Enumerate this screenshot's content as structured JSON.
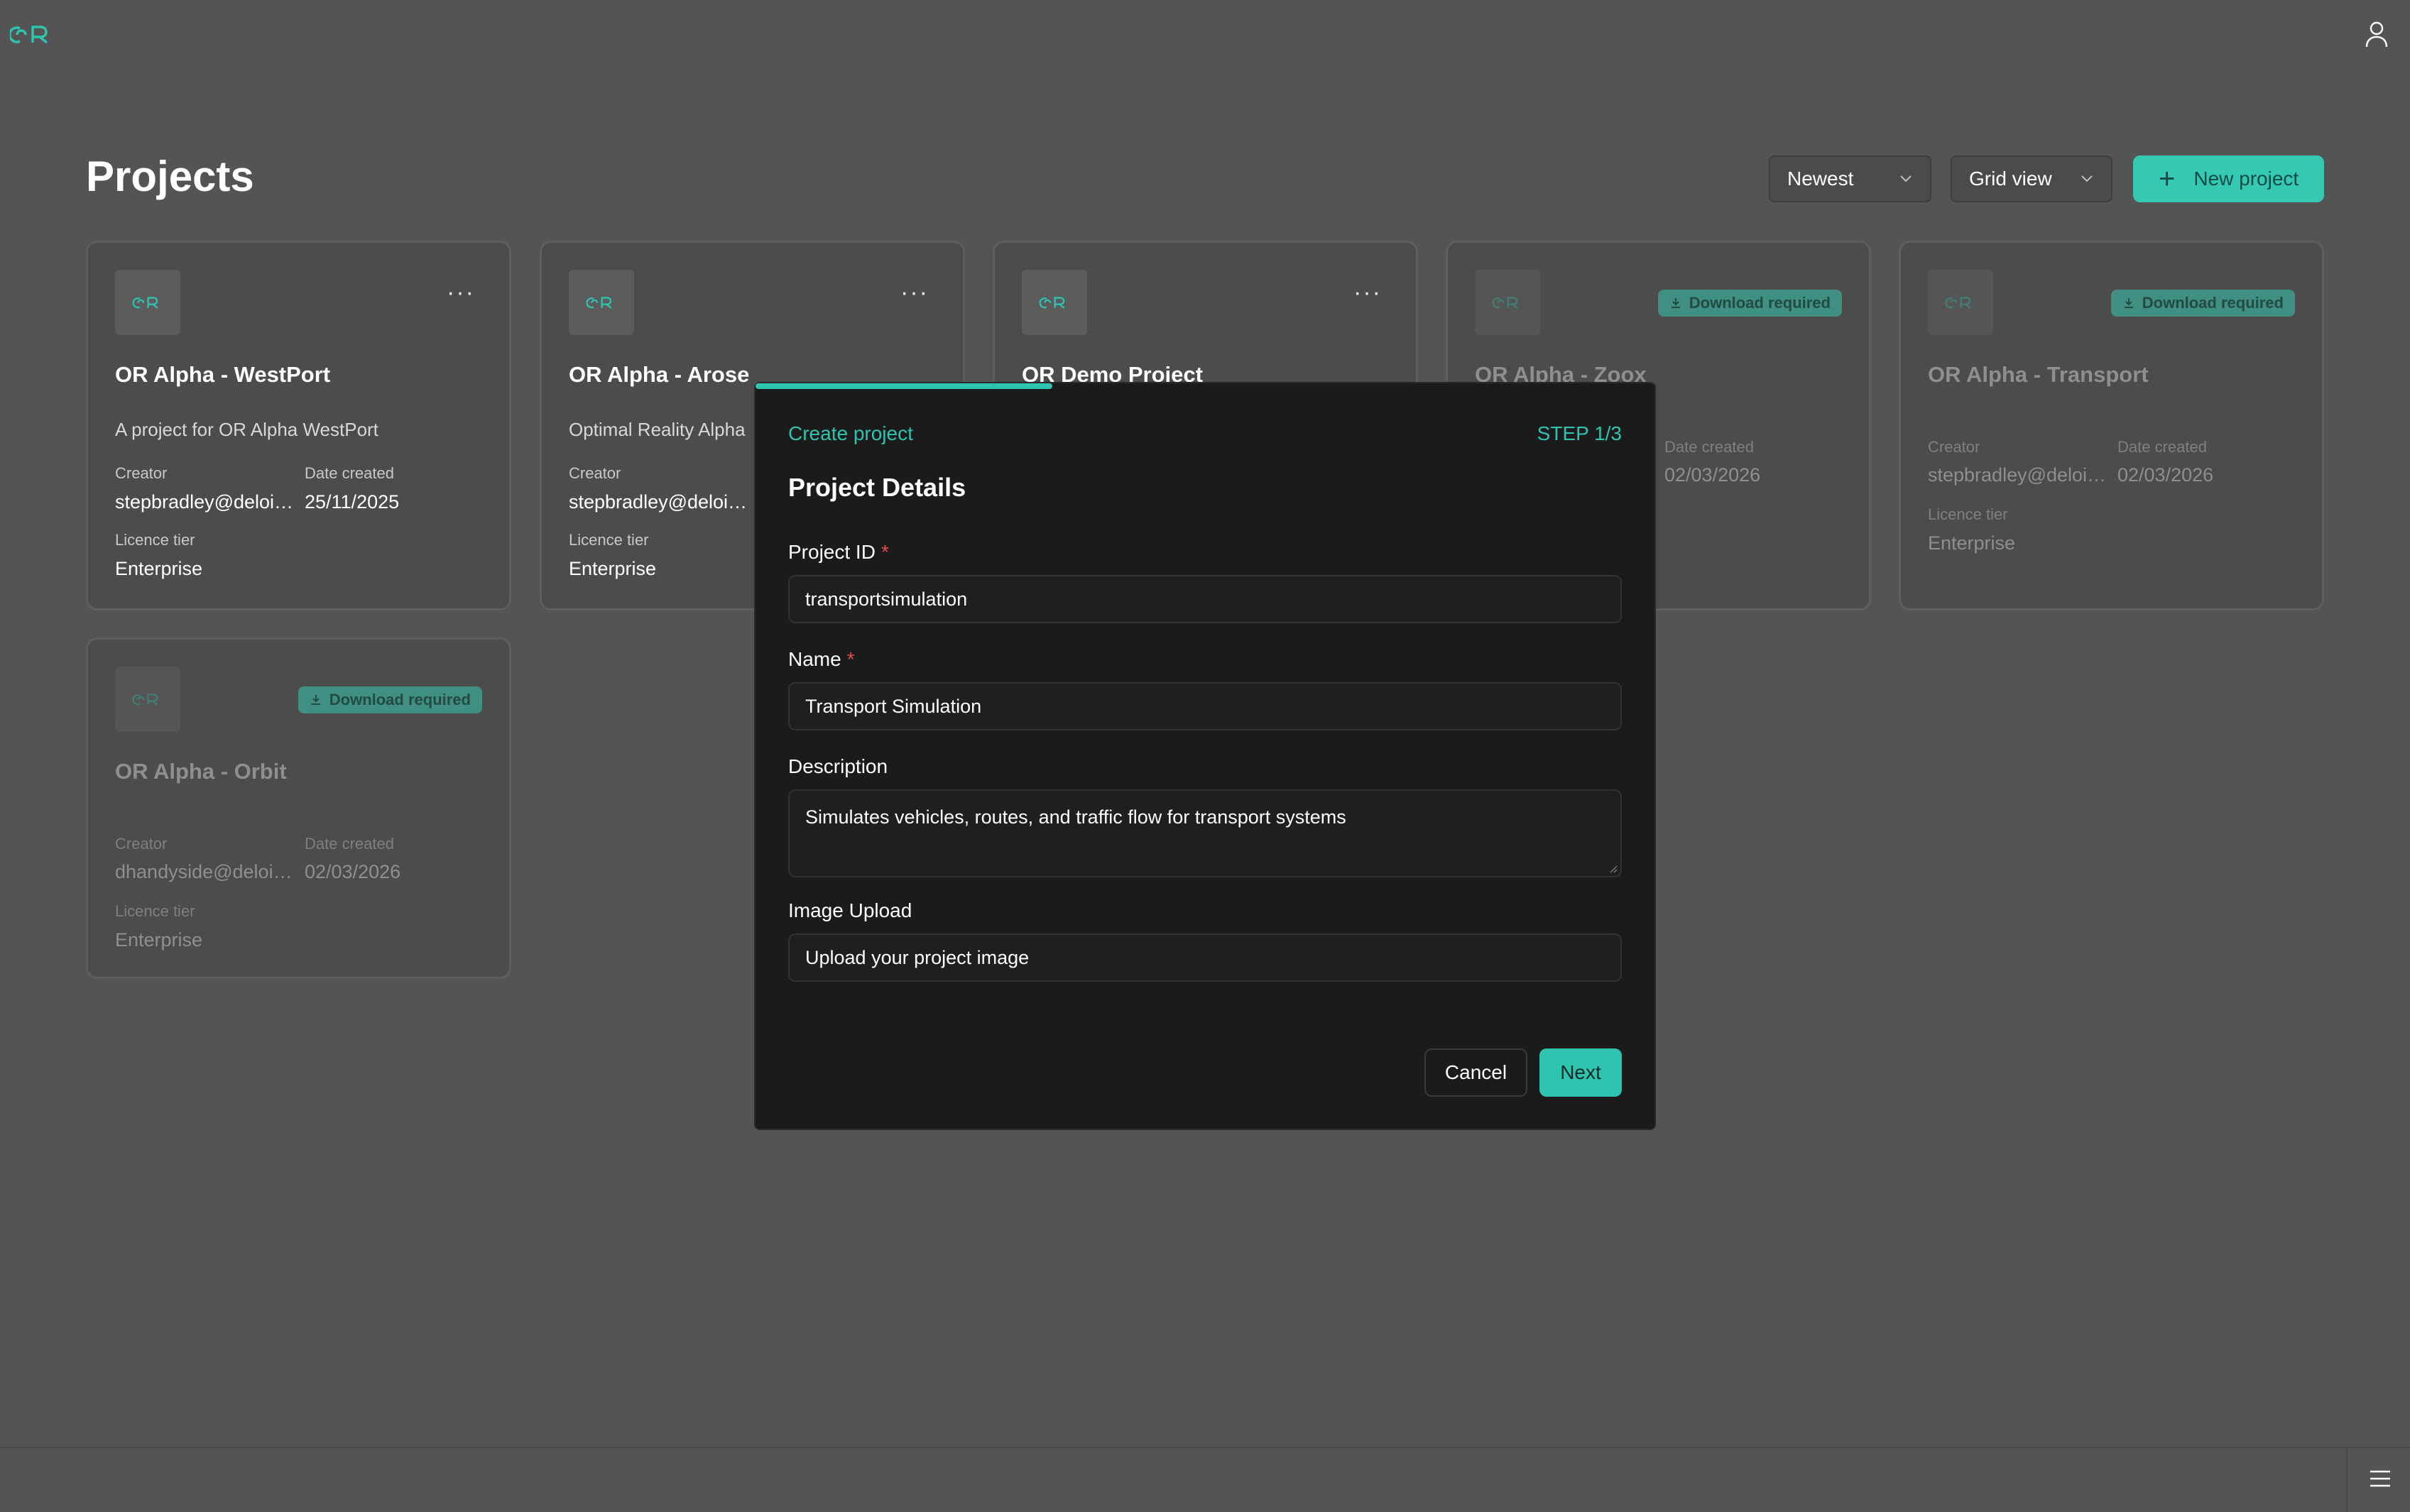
{
  "header": {
    "logo_text": "OR",
    "page_title": "Projects",
    "sort_value": "Newest",
    "view_value": "Grid view",
    "new_project_label": "New project"
  },
  "labels": {
    "creator": "Creator",
    "date_created": "Date created",
    "licence_tier": "Licence tier",
    "download_required": "Download required"
  },
  "cards": [
    {
      "title": "OR Alpha - WestPort",
      "description": "A project for OR Alpha WestPort",
      "creator": "stepbradley@deloi…",
      "date": "25/11/2025",
      "tier": "Enterprise",
      "state": "available"
    },
    {
      "title": "OR Alpha - Arose",
      "description": "Optimal Reality Alpha ",
      "creator": "stepbradley@deloi…",
      "date": "",
      "tier": "Enterprise",
      "state": "available"
    },
    {
      "title": "OR Demo Project",
      "description": "",
      "creator": "",
      "date": "",
      "tier": "",
      "state": "available"
    },
    {
      "title": "OR Alpha - Zoox",
      "description": "",
      "creator": "",
      "date": "02/03/2026",
      "tier": "",
      "state": "download-required"
    },
    {
      "title": "OR Alpha - Transport",
      "description": "",
      "creator": "stepbradley@deloi…",
      "date": "02/03/2026",
      "tier": "Enterprise",
      "state": "download-required"
    },
    {
      "title": "OR Alpha - Orbit",
      "description": "",
      "creator": "dhandyside@deloi…",
      "date": "02/03/2026",
      "tier": "Enterprise",
      "state": "download-required"
    }
  ],
  "modal": {
    "breadcrumb": "Create project",
    "step": "STEP 1/3",
    "progress_fraction": 0.33,
    "heading": "Project Details",
    "project_id_label": "Project ID",
    "project_id_value": "transportsimulation",
    "name_label": "Name",
    "name_value": "Transport Simulation",
    "description_label": "Description",
    "description_value": "Simulates vehicles, routes, and traffic flow for transport systems",
    "image_label": "Image Upload",
    "image_placeholder": "Upload your project image",
    "required_mark": "*",
    "cancel_label": "Cancel",
    "next_label": "Next"
  },
  "colors": {
    "accent": "#2ec4b0",
    "background": "#545454",
    "modal_bg": "#1b1b1b",
    "required": "#e14c4c"
  },
  "icons": [
    "or-logo-icon",
    "user-icon",
    "chevron-down-icon",
    "plus-icon",
    "more-icon",
    "download-icon",
    "menu-icon"
  ]
}
